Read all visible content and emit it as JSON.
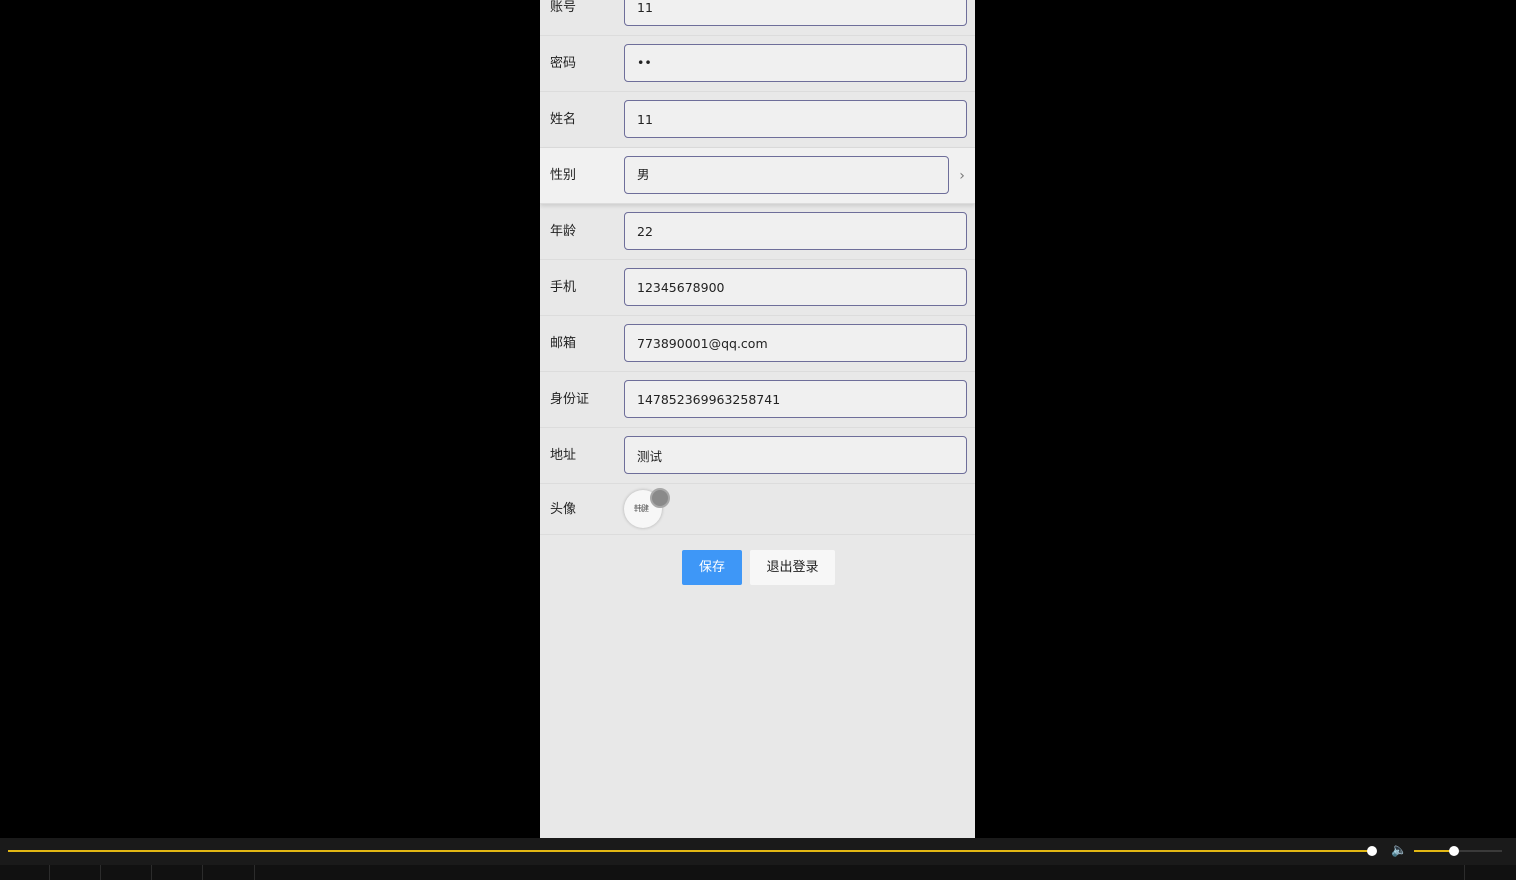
{
  "form": {
    "account": {
      "label": "账号",
      "value": "11"
    },
    "password": {
      "label": "密码",
      "value": "••"
    },
    "name": {
      "label": "姓名",
      "value": "11"
    },
    "gender": {
      "label": "性别",
      "value": "男",
      "chevron": "›"
    },
    "age": {
      "label": "年龄",
      "value": "22"
    },
    "phone": {
      "label": "手机",
      "value": "12345678900"
    },
    "email": {
      "label": "邮箱",
      "value": "773890001@qq.com"
    },
    "id_card": {
      "label": "身份证",
      "value": "147852369963258741"
    },
    "address": {
      "label": "地址",
      "value": "测试"
    },
    "avatar": {
      "label": "头像",
      "image_text": "韩健"
    }
  },
  "actions": {
    "save_label": "保存",
    "logout_label": "退出登录"
  },
  "player": {
    "progress": 1.0,
    "volume": 0.45,
    "volume_icon": "🔈",
    "accent_color": "#e2b714"
  },
  "colors": {
    "save_button": "#3e97f7",
    "page_background": "#e8e8e8",
    "field_border": "#6e6e9a"
  }
}
